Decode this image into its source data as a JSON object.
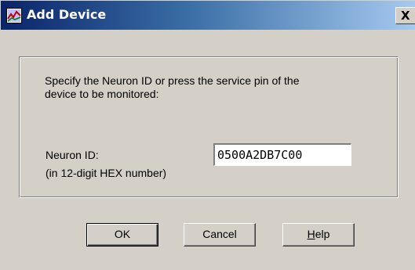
{
  "window": {
    "title": "Add Device",
    "close_glyph": "X",
    "title_icon": "device-monitor-icon"
  },
  "group": {
    "instruction_line1": "Specify the Neuron ID or press the service pin of the",
    "instruction_line2": "device to be monitored:",
    "neuron_id_label": "Neuron ID:",
    "neuron_id_hint": "(in 12-digit HEX number)",
    "neuron_id_value": "0500A2DB7C00"
  },
  "buttons": {
    "ok": "OK",
    "cancel": "Cancel",
    "help_mnemonic": "H",
    "help_rest": "elp"
  },
  "colors": {
    "titlebar_start": "#0a246a",
    "titlebar_end": "#a6caf0",
    "dialog_face": "#d4d0c8"
  }
}
